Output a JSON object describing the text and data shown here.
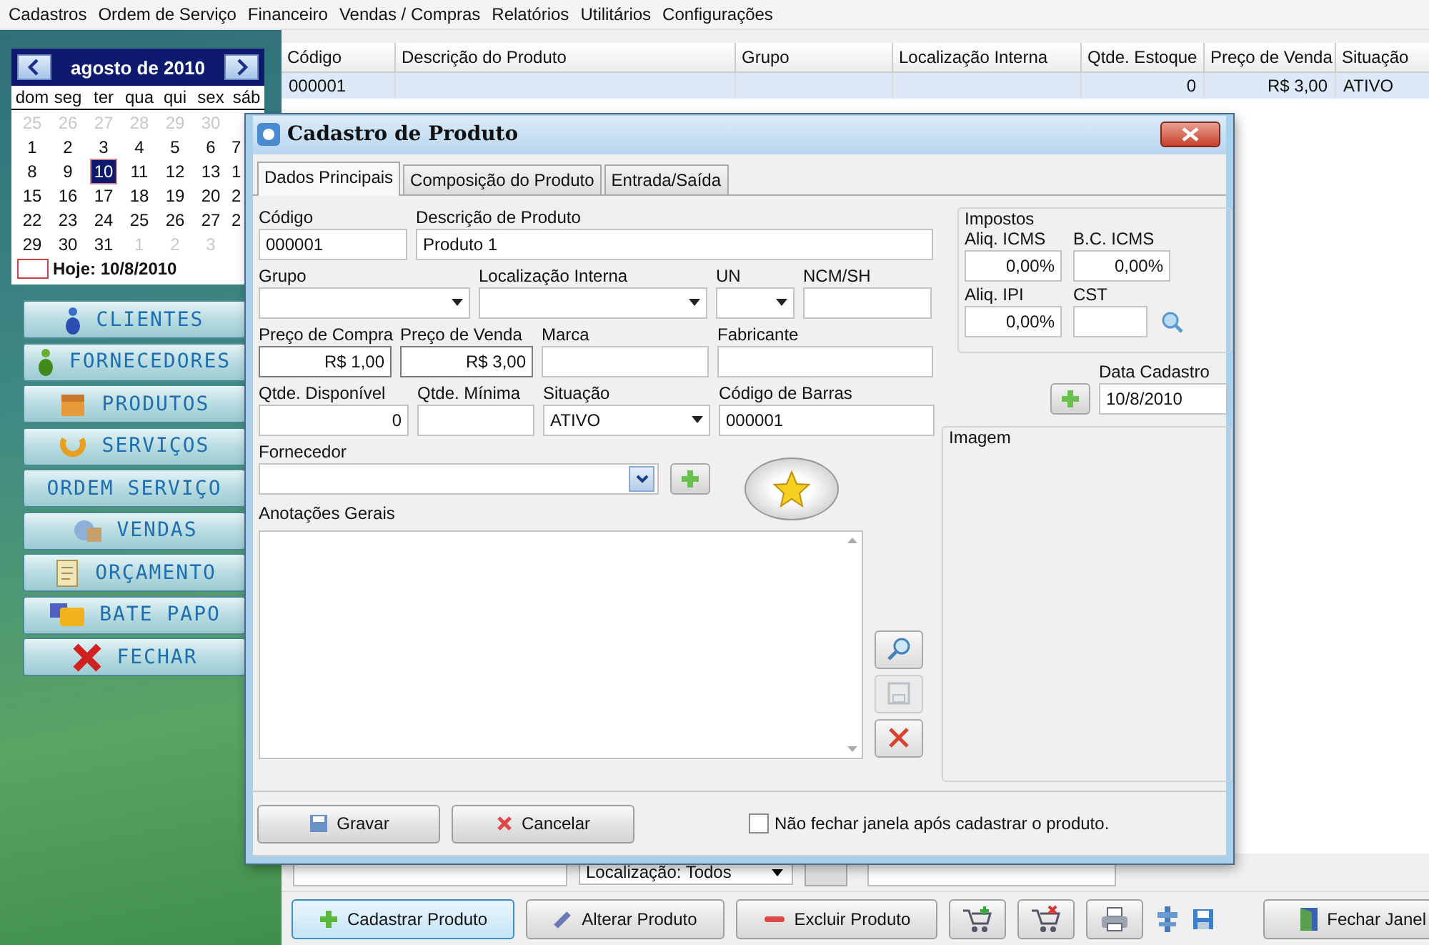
{
  "menu": [
    "Cadastros",
    "Ordem de Serviço",
    "Financeiro",
    "Vendas / Compras",
    "Relatórios",
    "Utilitários",
    "Configurações"
  ],
  "calendar": {
    "month": "agosto de 2010",
    "weekdays": [
      "dom",
      "seg",
      "ter",
      "qua",
      "qui",
      "sex",
      "sáb"
    ],
    "weeks": [
      [
        {
          "day": "25",
          "other_month": true,
          "selected": false
        },
        {
          "day": "26",
          "other_month": true,
          "selected": false
        },
        {
          "day": "27",
          "other_month": true,
          "selected": false
        },
        {
          "day": "28",
          "other_month": true,
          "selected": false
        },
        {
          "day": "29",
          "other_month": true,
          "selected": false
        },
        {
          "day": "30",
          "other_month": true,
          "selected": false
        }
      ],
      [
        {
          "day": "1",
          "other_month": false,
          "selected": false
        },
        {
          "day": "2",
          "other_month": false,
          "selected": false
        },
        {
          "day": "3",
          "other_month": false,
          "selected": false
        },
        {
          "day": "4",
          "other_month": false,
          "selected": false
        },
        {
          "day": "5",
          "other_month": false,
          "selected": false
        },
        {
          "day": "6",
          "other_month": false,
          "selected": false
        },
        {
          "day": "7",
          "other_month": false,
          "selected": false
        }
      ],
      [
        {
          "day": "8",
          "other_month": false,
          "selected": false
        },
        {
          "day": "9",
          "other_month": false,
          "selected": false
        },
        {
          "day": "10",
          "other_month": false,
          "selected": true
        },
        {
          "day": "11",
          "other_month": false,
          "selected": false
        },
        {
          "day": "12",
          "other_month": false,
          "selected": false
        },
        {
          "day": "13",
          "other_month": false,
          "selected": false
        },
        {
          "day": "1",
          "other_month": false,
          "selected": false
        }
      ],
      [
        {
          "day": "15",
          "other_month": false,
          "selected": false
        },
        {
          "day": "16",
          "other_month": false,
          "selected": false
        },
        {
          "day": "17",
          "other_month": false,
          "selected": false
        },
        {
          "day": "18",
          "other_month": false,
          "selected": false
        },
        {
          "day": "19",
          "other_month": false,
          "selected": false
        },
        {
          "day": "20",
          "other_month": false,
          "selected": false
        },
        {
          "day": "2",
          "other_month": false,
          "selected": false
        }
      ],
      [
        {
          "day": "22",
          "other_month": false,
          "selected": false
        },
        {
          "day": "23",
          "other_month": false,
          "selected": false
        },
        {
          "day": "24",
          "other_month": false,
          "selected": false
        },
        {
          "day": "25",
          "other_month": false,
          "selected": false
        },
        {
          "day": "26",
          "other_month": false,
          "selected": false
        },
        {
          "day": "27",
          "other_month": false,
          "selected": false
        },
        {
          "day": "2",
          "other_month": false,
          "selected": false
        }
      ],
      [
        {
          "day": "29",
          "other_month": false,
          "selected": false
        },
        {
          "day": "30",
          "other_month": false,
          "selected": false
        },
        {
          "day": "31",
          "other_month": false,
          "selected": false
        },
        {
          "day": "1",
          "other_month": true,
          "selected": false
        },
        {
          "day": "2",
          "other_month": true,
          "selected": false
        },
        {
          "day": "3",
          "other_month": true,
          "selected": false
        }
      ]
    ],
    "today": "Hoje: 10/8/2010"
  },
  "nav": [
    "CLIENTES",
    "FORNECEDORES",
    "PRODUTOS",
    "SERVIÇOS",
    "ORDEM SERVIÇO",
    "VENDAS",
    "ORÇAMENTO",
    "BATE PAPO",
    "FECHAR"
  ],
  "table": {
    "columns": [
      "Código",
      "Descrição do Produto",
      "Grupo",
      "Localização Interna",
      "Qtde. Estoque",
      "Preço de Venda",
      "Situação"
    ],
    "rows": [
      {
        "selected": true,
        "cells": [
          "000001",
          null,
          null,
          null,
          "0",
          "R$ 3,00",
          "ATIVO"
        ]
      }
    ]
  },
  "filter": {
    "location": "Localização: Todos"
  },
  "toolbar": [
    {
      "label": "Cadastrar Produto",
      "selected": true
    },
    {
      "label": "Alterar Produto",
      "selected": false
    },
    {
      "label": "Excluir Produto",
      "selected": false
    }
  ],
  "close_window": "Fechar Janel",
  "dialog": {
    "title": "Cadastro de Produto",
    "tabs": [
      {
        "label": "Dados Principais",
        "selected": true
      },
      {
        "label": "Composição do Produto",
        "selected": false
      },
      {
        "label": "Entrada/Saída",
        "selected": false
      }
    ],
    "fields": [
      {
        "label": "Código",
        "value": "000001",
        "kind": "text"
      },
      {
        "label": "Descrição de Produto",
        "value": "Produto 1",
        "kind": "text"
      },
      {
        "label": "Grupo",
        "kind": "dropdown"
      },
      {
        "label": "Localização Interna",
        "kind": "dropdown"
      },
      {
        "label": "UN",
        "kind": "dropdown"
      },
      {
        "label": "NCM/SH",
        "kind": "text"
      },
      {
        "label": "Preço de Compra",
        "value": "R$ 1,00",
        "kind": "number"
      },
      {
        "label": "Preço de Venda",
        "value": "R$ 3,00",
        "kind": "number"
      },
      {
        "label": "Marca",
        "kind": "text"
      },
      {
        "label": "Fabricante",
        "kind": "text"
      },
      {
        "label": "Qtde. Disponível",
        "value": "0",
        "kind": "number"
      },
      {
        "label": "Qtde. Mínima",
        "kind": "text"
      },
      {
        "label": "Situação",
        "value": "ATIVO",
        "kind": "dropdown"
      },
      {
        "label": "Código de Barras",
        "value": "000001",
        "kind": "text"
      }
    ],
    "supplier": {
      "label": "Fornecedor"
    },
    "notes": {
      "label": "Anotações Gerais"
    },
    "note_buttons": [
      {
        "disabled": false
      },
      {
        "disabled": true
      },
      {
        "disabled": false
      }
    ],
    "taxes": {
      "title": "Impostos",
      "fields": [
        {
          "label": "Aliq. ICMS",
          "value": "0,00%"
        },
        {
          "label": "B.C. ICMS",
          "value": "0,00%"
        },
        {
          "label": "Aliq. IPI",
          "value": "0,00%"
        },
        {
          "label": "CST"
        }
      ]
    },
    "date": {
      "label": "Data Cadastro",
      "value": "10/8/2010"
    },
    "image": {
      "title": "Imagem"
    },
    "buttons": [
      "Gravar",
      "Cancelar"
    ],
    "keep_open": {
      "label": "Não fechar janela após cadastrar o produto.",
      "checked": false
    }
  }
}
